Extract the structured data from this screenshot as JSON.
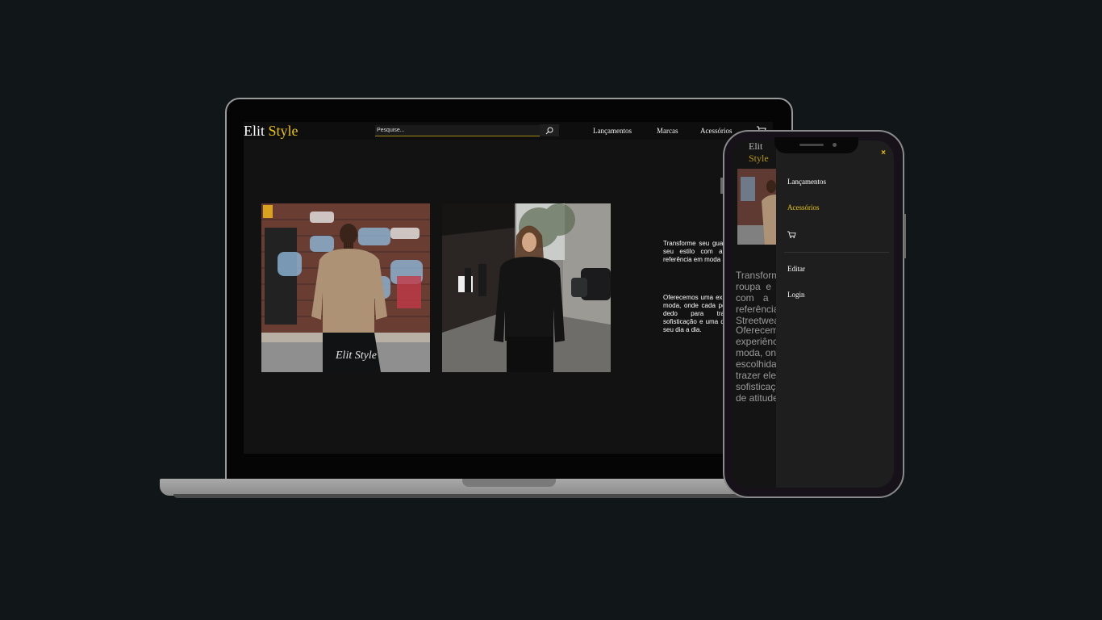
{
  "desktop": {
    "logo": {
      "part1": "Elit",
      "part2": "Style"
    },
    "search": {
      "placeholder": "Pesquise..."
    },
    "nav": [
      "Lançamentos",
      "Marcas",
      "Acessórios"
    ],
    "hero": {
      "paragraph1": "Transforme seu guarda-roupa e eleve seu estilo com a Elit Style, sua referência em moda Streetwear.",
      "paragraph2": "Oferecemos uma experiência única de moda, onde cada peça é escolhida a dedo para trazer elegância, sofisticação e uma dose de atitude ao seu dia a dia."
    },
    "photos": [
      {
        "alt": "man-in-beige-sweatshirt",
        "print": "Elit Style"
      },
      {
        "alt": "woman-in-black-sweatshirt"
      }
    ]
  },
  "mobile": {
    "logo": {
      "part1": "Elit",
      "part2": "Style"
    },
    "close_label": "×",
    "menu": [
      "Lançamentos",
      "Acessórios"
    ],
    "menu_secondary": [
      "Editar",
      "Login"
    ],
    "hero": {
      "paragraph1": "Transforme seu guarda-roupa e eleve seu estilo com a Elit Style, sua referência em moda Streetwear.",
      "paragraph2": "Oferecemos uma experiência única de moda, onde cada peça é escolhida a dedo para trazer elegância, sofisticação e uma dose de atitude."
    }
  },
  "colors": {
    "background": "#111619",
    "accent": "#e8c40a",
    "page": "#121212",
    "drawer": "#1e1e1e"
  },
  "icons": [
    "search-icon",
    "cart-icon",
    "close-icon"
  ]
}
